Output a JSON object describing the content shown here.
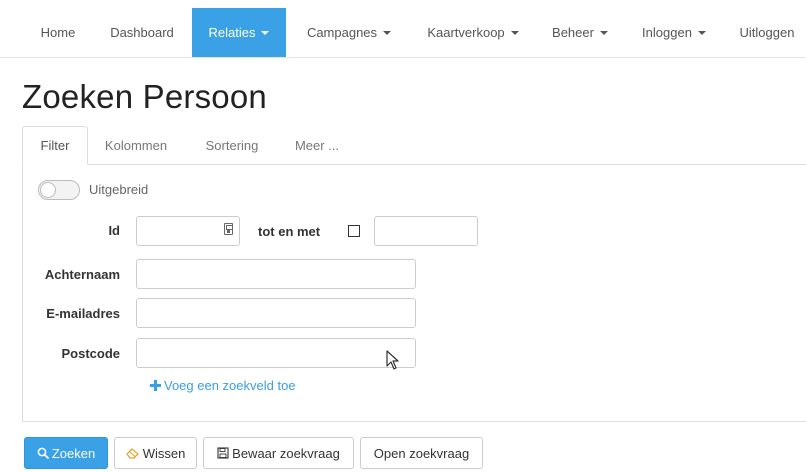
{
  "navbar": {
    "items": [
      {
        "label": "Home",
        "active": false,
        "dropdown": false
      },
      {
        "label": "Dashboard",
        "active": false,
        "dropdown": false
      },
      {
        "label": "Relaties",
        "active": true,
        "dropdown": true
      },
      {
        "label": "Campagnes",
        "active": false,
        "dropdown": true
      },
      {
        "label": "Kaartverkoop",
        "active": false,
        "dropdown": true
      },
      {
        "label": "Beheer",
        "active": false,
        "dropdown": true
      },
      {
        "label": "Inloggen",
        "active": false,
        "dropdown": true
      },
      {
        "label": "Uitloggen",
        "active": false,
        "dropdown": false
      }
    ]
  },
  "page": {
    "title": "Zoeken Persoon"
  },
  "tabs": [
    {
      "label": "Filter",
      "active": true
    },
    {
      "label": "Kolommen",
      "active": false
    },
    {
      "label": "Sortering",
      "active": false
    },
    {
      "label": "Meer ...",
      "active": false
    }
  ],
  "filter": {
    "toggle_label": "Uitgebreid",
    "toggle_on": false,
    "id_label": "Id",
    "id_value": "",
    "range_label": "tot en met",
    "range_checked": false,
    "id_to_value": "",
    "achternaam_label": "Achternaam",
    "achternaam_value": "",
    "email_label": "E-mailadres",
    "email_value": "",
    "postcode_label": "Postcode",
    "postcode_value": "",
    "add_field_label": "Voeg een zoekveld toe"
  },
  "actions": {
    "search_label": "Zoeken",
    "clear_label": "Wissen",
    "save_query_label": "Bewaar zoekvraag",
    "open_query_label": "Open zoekvraag"
  },
  "colors": {
    "accent": "#3aa1e6",
    "link": "#3a9ee4",
    "clear_icon": "#f0a030"
  },
  "icons": {
    "search": "search-icon",
    "clear": "eraser-icon",
    "save": "floppy-disk-icon",
    "add": "plus-icon",
    "id_picker": "calculator-icon"
  }
}
